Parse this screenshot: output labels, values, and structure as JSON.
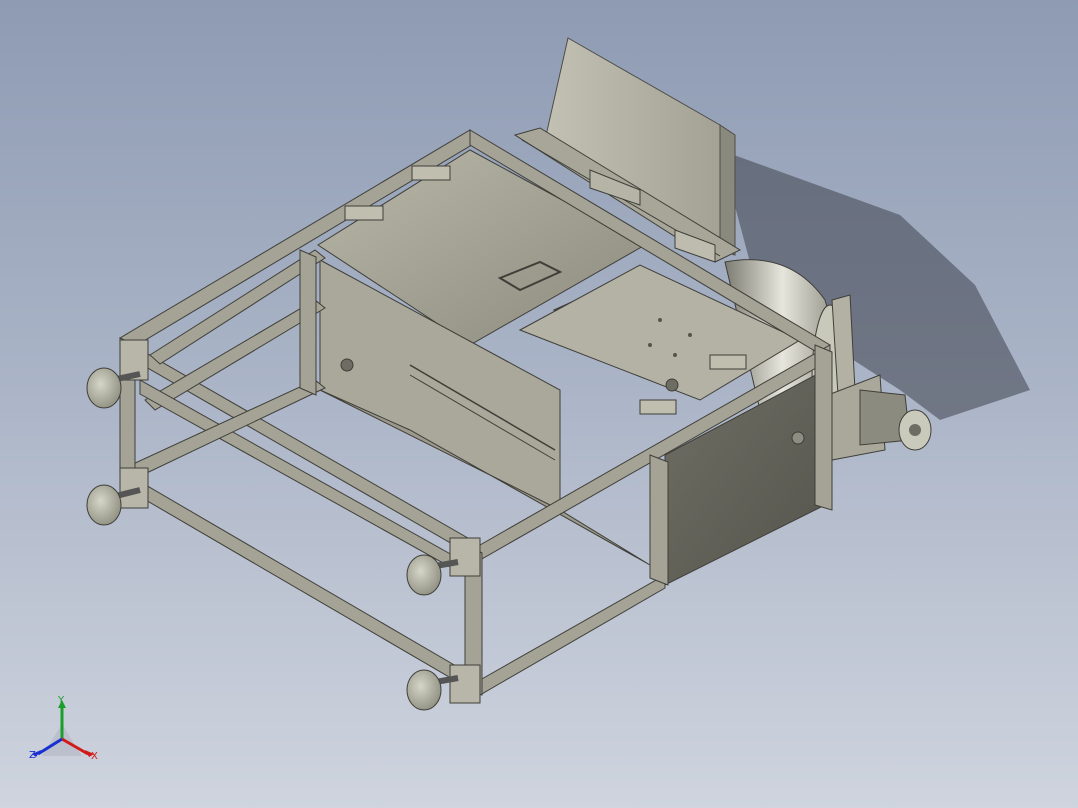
{
  "viewport": {
    "background_top": "#8e9bb3",
    "background_bottom": "#cfd4de",
    "model_color": "#9a9a8c"
  },
  "triad": {
    "y_label": "Y",
    "z_label": "Z",
    "x_label": "X",
    "y_color": "#1b9e2b",
    "z_color": "#1a2fd0",
    "x_color": "#d21a1a"
  }
}
